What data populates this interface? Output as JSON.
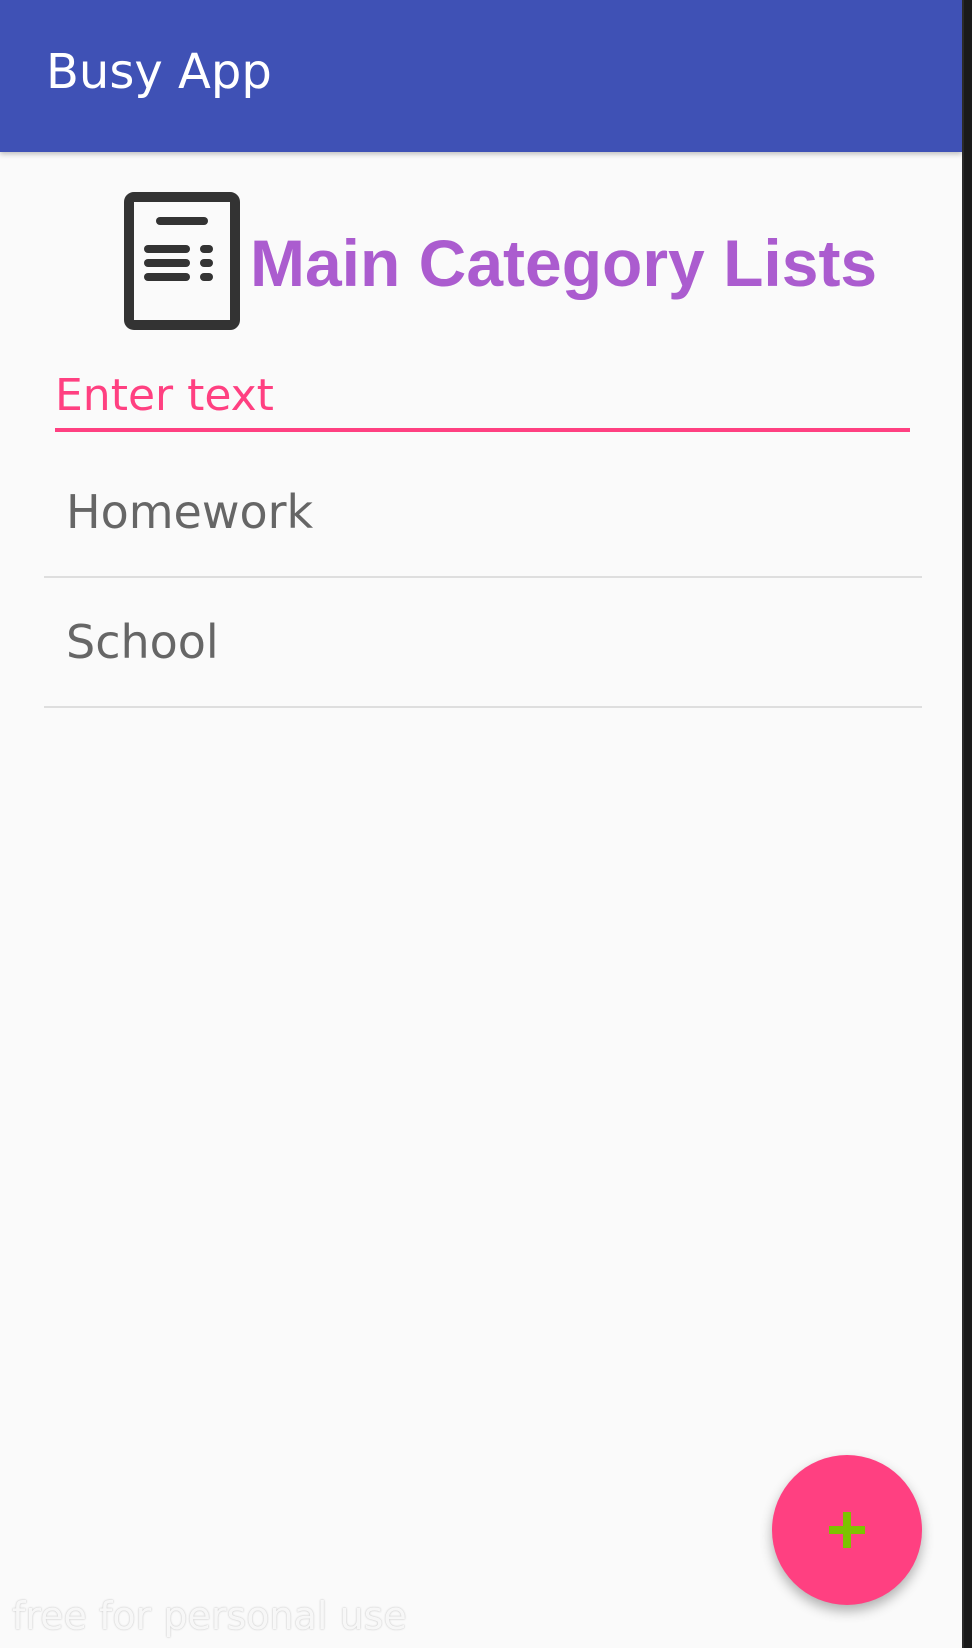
{
  "app_bar": {
    "title": "Busy App",
    "background_color": "#3f51b5"
  },
  "header": {
    "icon": "list-document-icon",
    "title": "Main Category Lists",
    "title_color": "#ab5ccf"
  },
  "input": {
    "placeholder": "Enter text",
    "value": "",
    "accent_color": "#ff4081"
  },
  "categories": [
    {
      "label": "Homework"
    },
    {
      "label": "School"
    }
  ],
  "fab": {
    "icon": "plus-icon",
    "background_color": "#ff4081",
    "icon_color": "#7cc400"
  },
  "watermark": {
    "text": "free for personal use"
  }
}
